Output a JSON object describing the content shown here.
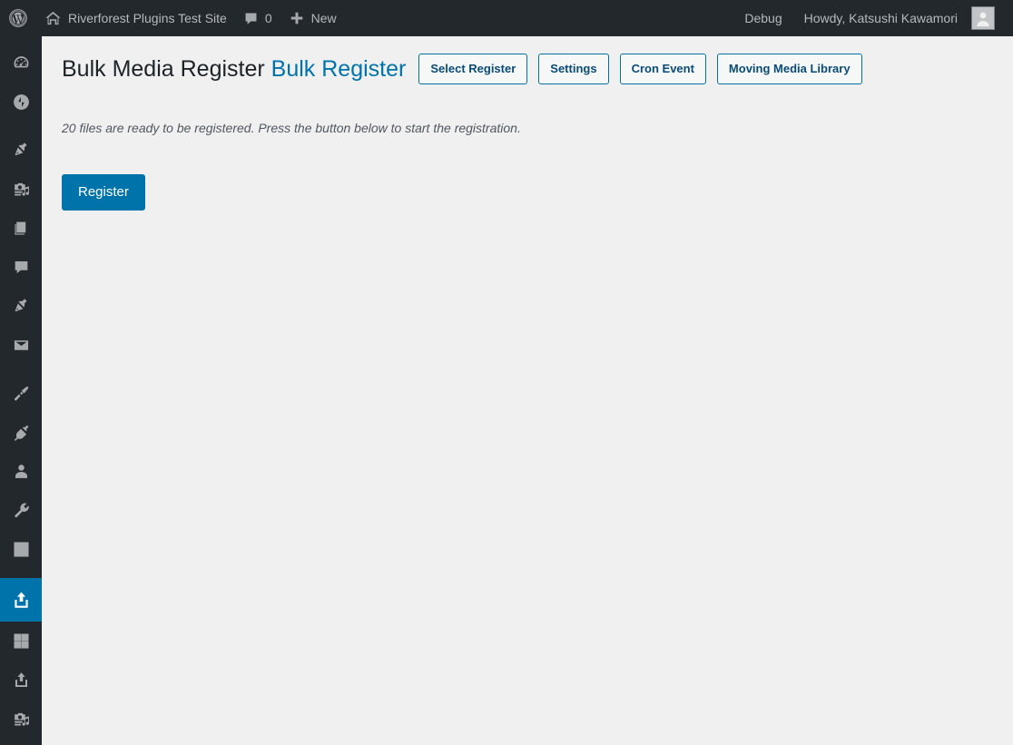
{
  "adminbar": {
    "wp_logo_label": "About WordPress",
    "site_name": "Riverforest Plugins Test Site",
    "comments_count": "0",
    "new_label": "New",
    "debug_label": "Debug",
    "howdy": "Howdy, Katsushi Kawamori",
    "icons": {
      "wp": "wordpress-logo-icon",
      "home": "home-icon",
      "comment": "comment-bubble-icon",
      "plus": "plus-icon",
      "avatar": "user-avatar-icon"
    }
  },
  "sidebar": {
    "items": [
      {
        "name": "sidebar-item-dashboard",
        "icon": "dashboard-gauge-icon",
        "current": false
      },
      {
        "name": "sidebar-item-jetpack",
        "icon": "jetpack-icon",
        "current": false
      },
      {
        "name": "sidebar-item-posts",
        "icon": "pin-icon",
        "current": false
      },
      {
        "name": "sidebar-item-media",
        "icon": "media-camera-music-icon",
        "current": false
      },
      {
        "name": "sidebar-item-pages",
        "icon": "pages-icon",
        "current": false
      },
      {
        "name": "sidebar-item-comments",
        "icon": "comment-bubble-icon",
        "current": false
      },
      {
        "name": "sidebar-item-custom-post",
        "icon": "pin-icon",
        "current": false
      },
      {
        "name": "sidebar-item-mail",
        "icon": "mail-envelope-icon",
        "current": false
      },
      {
        "name": "sidebar-item-appearance",
        "icon": "paintbrush-icon",
        "current": false
      },
      {
        "name": "sidebar-item-plugins",
        "icon": "plug-icon",
        "current": false
      },
      {
        "name": "sidebar-item-users",
        "icon": "user-icon",
        "current": false
      },
      {
        "name": "sidebar-item-tools",
        "icon": "wrench-icon",
        "current": false
      },
      {
        "name": "sidebar-item-settings",
        "icon": "settings-sliders-icon",
        "current": false
      },
      {
        "name": "sidebar-item-bulk-media-register",
        "icon": "upload-icon",
        "current": true
      },
      {
        "name": "sidebar-item-grid",
        "icon": "grid-icon",
        "current": false
      },
      {
        "name": "sidebar-item-upload",
        "icon": "upload-icon",
        "current": false
      },
      {
        "name": "sidebar-item-media-2",
        "icon": "media-camera-music-icon",
        "current": false
      }
    ]
  },
  "page": {
    "title_main": "Bulk Media Register",
    "title_sub": "Bulk Register",
    "actions": [
      {
        "name": "select-register-button",
        "label": "Select Register"
      },
      {
        "name": "settings-button",
        "label": "Settings"
      },
      {
        "name": "cron-event-button",
        "label": "Cron Event"
      },
      {
        "name": "moving-media-library-button",
        "label": "Moving Media Library"
      }
    ],
    "description": "20 files are ready to be registered. Press the button below to start the registration.",
    "register_label": "Register"
  },
  "colors": {
    "admin_bar_bg": "#23282d",
    "sidebar_bg": "#23282d",
    "content_bg": "#f0f0f1",
    "accent_blue": "#0073aa",
    "button_border": "#0071a1",
    "button_text": "#0a4b78",
    "description_text": "#50575e"
  }
}
